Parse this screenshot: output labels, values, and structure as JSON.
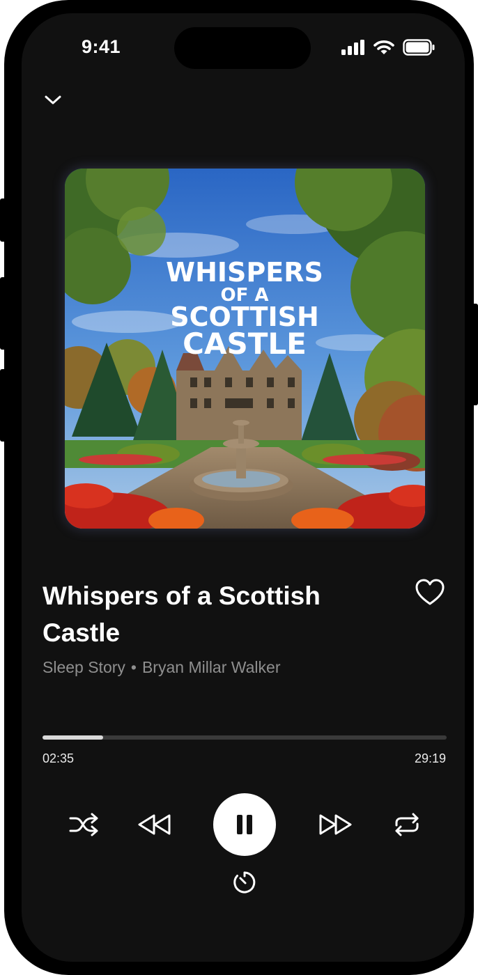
{
  "status_bar": {
    "time": "9:41"
  },
  "player": {
    "artwork": {
      "title_lines": [
        "WHISPERS",
        "OF A",
        "SCOTTISH",
        "CASTLE"
      ]
    },
    "title": "Whispers of a Scottish Castle",
    "category": "Sleep Story",
    "separator": "•",
    "narrator": "Bryan Millar Walker",
    "progress": {
      "elapsed": "02:35",
      "total": "29:19",
      "fraction": 0.15
    },
    "state": "playing"
  },
  "icons": {
    "collapse": "chevron-down-icon",
    "like": "heart-outline-icon",
    "shuffle": "shuffle-icon",
    "rewind": "rewind-icon",
    "pause": "pause-icon",
    "fast_forward": "fast-forward-icon",
    "repeat": "repeat-icon",
    "sleep_timer": "timer-icon"
  },
  "colors": {
    "background": "#111111",
    "text_primary": "#ffffff",
    "text_secondary": "#8f8f8f",
    "progress_fill": "#d9d9d9",
    "progress_track": "#3a3a3a"
  }
}
